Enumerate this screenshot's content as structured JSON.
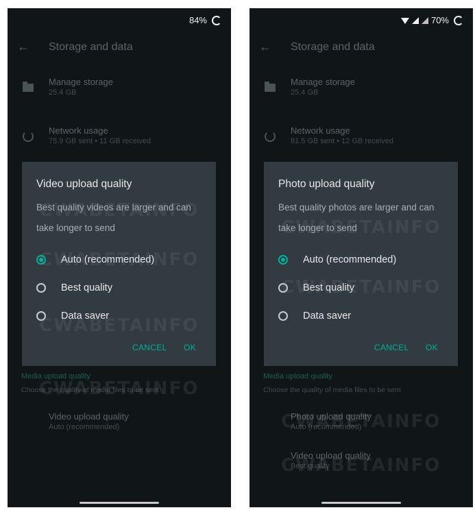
{
  "left": {
    "status": {
      "battery": "84%"
    },
    "appbar": {
      "title": "Storage and data"
    },
    "rows": {
      "manage_storage": {
        "title": "Manage storage",
        "subtitle": "25.4 GB"
      },
      "network_usage": {
        "title": "Network usage",
        "subtitle": "75.9 GB sent • 11 GB received"
      }
    },
    "section": {
      "header": "Media upload quality",
      "description": "Choose the quality of media files to be sent"
    },
    "settings": [
      {
        "title": "Video upload quality",
        "subtitle": "Auto (recommended)"
      }
    ],
    "dialog": {
      "title": "Video upload quality",
      "message": "Best quality videos are larger and can take longer to send",
      "options": [
        {
          "label": "Auto (recommended)",
          "selected": true
        },
        {
          "label": "Best quality",
          "selected": false
        },
        {
          "label": "Data saver",
          "selected": false
        }
      ],
      "cancel": "CANCEL",
      "ok": "OK"
    },
    "watermark": "CWABETAINFO"
  },
  "right": {
    "status": {
      "battery": "70%"
    },
    "appbar": {
      "title": "Storage and data"
    },
    "rows": {
      "manage_storage": {
        "title": "Manage storage",
        "subtitle": "25.4 GB"
      },
      "network_usage": {
        "title": "Network usage",
        "subtitle": "81.5 GB sent • 12 GB received"
      }
    },
    "section": {
      "header": "Media upload quality",
      "description": "Choose the quality of media files to be sent"
    },
    "settings": [
      {
        "title": "Photo upload quality",
        "subtitle": "Auto (recommended)"
      },
      {
        "title": "Video upload quality",
        "subtitle": "Best quality"
      }
    ],
    "dialog": {
      "title": "Photo upload quality",
      "message": "Best quality photos are larger and can take longer to send",
      "options": [
        {
          "label": "Auto (recommended)",
          "selected": true
        },
        {
          "label": "Best quality",
          "selected": false
        },
        {
          "label": "Data saver",
          "selected": false
        }
      ],
      "cancel": "CANCEL",
      "ok": "OK"
    },
    "watermark": "CWABETAINFO"
  },
  "colors": {
    "accent": "#00af9c",
    "background": "#101518",
    "dialog": "#323b3f"
  }
}
